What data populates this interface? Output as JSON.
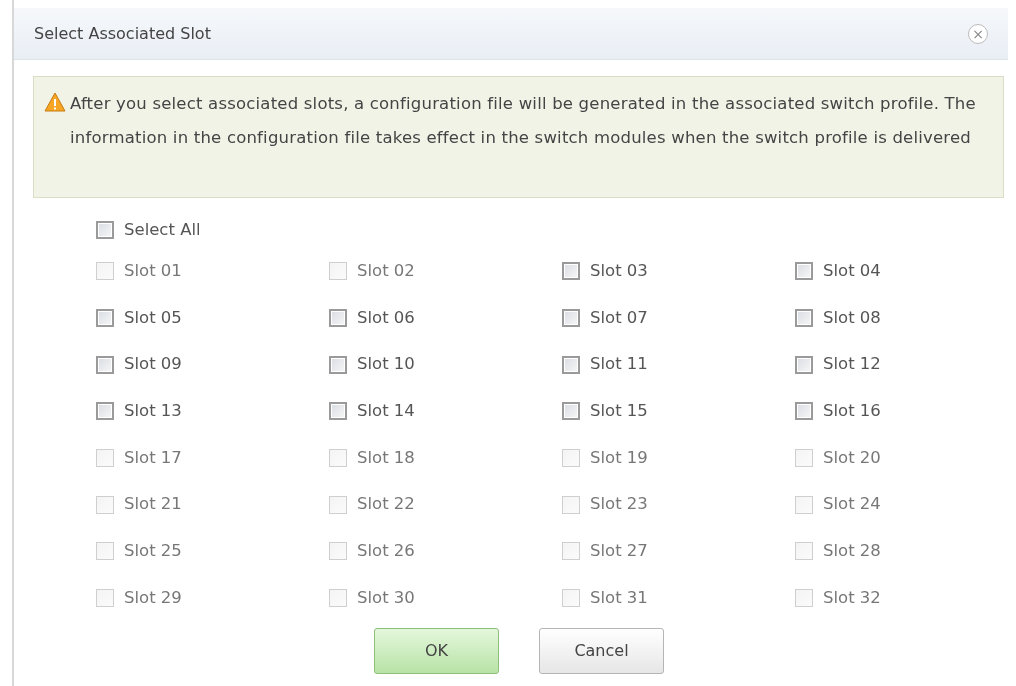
{
  "dialog": {
    "title": "Select Associated Slot",
    "close": "×"
  },
  "warning": "After you select associated slots, a configuration file will be generated in the associated switch profile. The information in the configuration file takes effect in the switch modules when the switch profile is delivered",
  "select_all": {
    "label": "Select All",
    "disabled": false
  },
  "slots": [
    {
      "label": "Slot 01",
      "disabled": true
    },
    {
      "label": "Slot 02",
      "disabled": true
    },
    {
      "label": "Slot 03",
      "disabled": false
    },
    {
      "label": "Slot 04",
      "disabled": false
    },
    {
      "label": "Slot 05",
      "disabled": false
    },
    {
      "label": "Slot 06",
      "disabled": false
    },
    {
      "label": "Slot 07",
      "disabled": false
    },
    {
      "label": "Slot 08",
      "disabled": false
    },
    {
      "label": "Slot 09",
      "disabled": false
    },
    {
      "label": "Slot 10",
      "disabled": false
    },
    {
      "label": "Slot 11",
      "disabled": false
    },
    {
      "label": "Slot 12",
      "disabled": false
    },
    {
      "label": "Slot 13",
      "disabled": false
    },
    {
      "label": "Slot 14",
      "disabled": false
    },
    {
      "label": "Slot 15",
      "disabled": false
    },
    {
      "label": "Slot 16",
      "disabled": false
    },
    {
      "label": "Slot 17",
      "disabled": true
    },
    {
      "label": "Slot 18",
      "disabled": true
    },
    {
      "label": "Slot 19",
      "disabled": true
    },
    {
      "label": "Slot 20",
      "disabled": true
    },
    {
      "label": "Slot 21",
      "disabled": true
    },
    {
      "label": "Slot 22",
      "disabled": true
    },
    {
      "label": "Slot 23",
      "disabled": true
    },
    {
      "label": "Slot 24",
      "disabled": true
    },
    {
      "label": "Slot 25",
      "disabled": true
    },
    {
      "label": "Slot 26",
      "disabled": true
    },
    {
      "label": "Slot 27",
      "disabled": true
    },
    {
      "label": "Slot 28",
      "disabled": true
    },
    {
      "label": "Slot 29",
      "disabled": true
    },
    {
      "label": "Slot 30",
      "disabled": true
    },
    {
      "label": "Slot 31",
      "disabled": true
    },
    {
      "label": "Slot 32",
      "disabled": true
    }
  ],
  "buttons": [
    {
      "label": "OK",
      "kind": "primary"
    },
    {
      "label": "Cancel",
      "kind": "secondary"
    }
  ]
}
